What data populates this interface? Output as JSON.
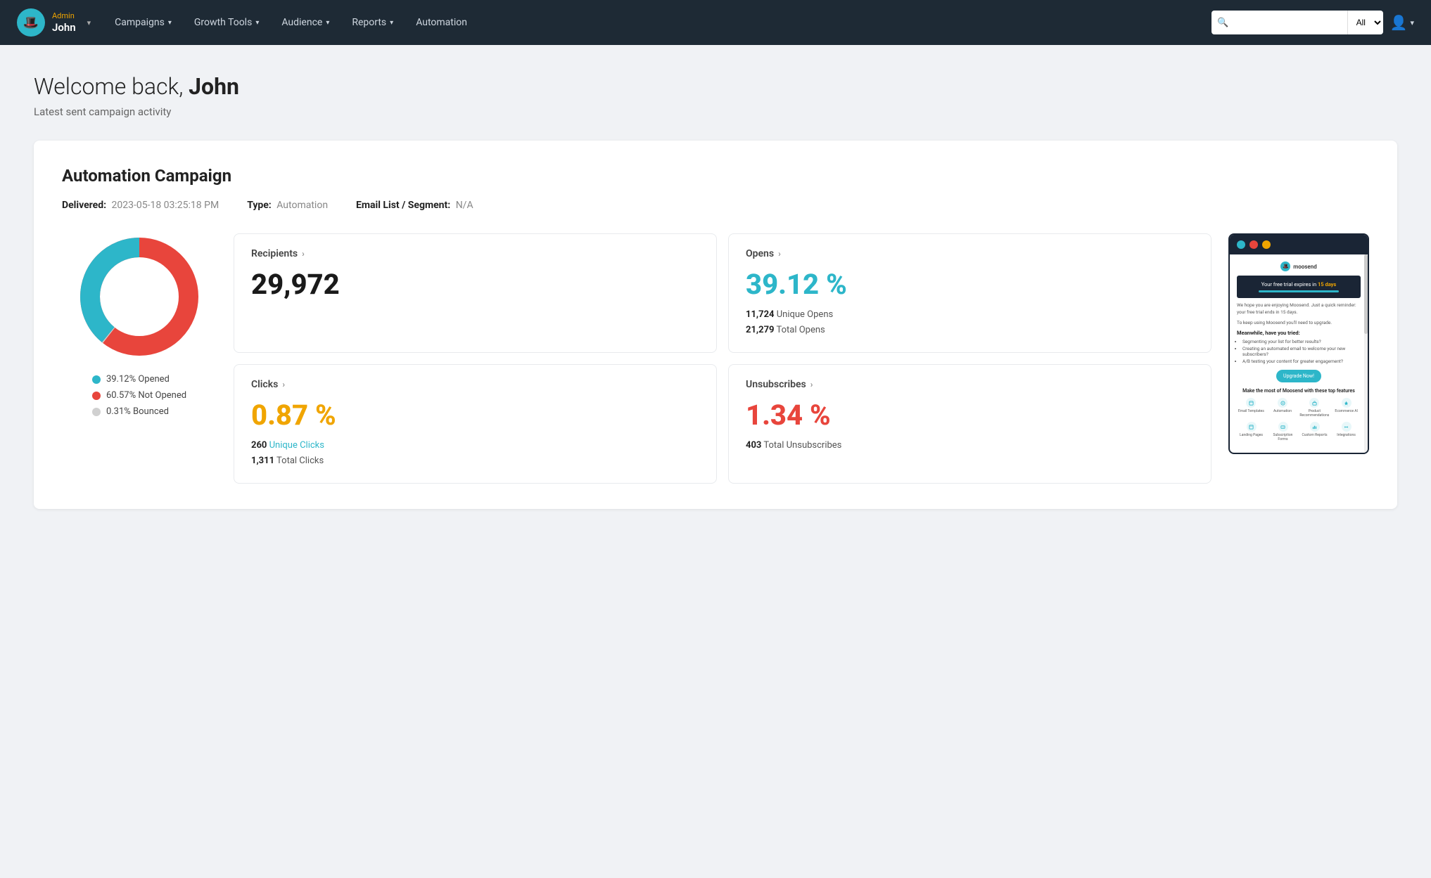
{
  "navbar": {
    "logo_emoji": "🎩",
    "user_role": "Admin",
    "user_name": "John",
    "nav_items": [
      {
        "label": "Campaigns",
        "has_dropdown": true
      },
      {
        "label": "Growth Tools",
        "has_dropdown": true
      },
      {
        "label": "Audience",
        "has_dropdown": true
      },
      {
        "label": "Reports",
        "has_dropdown": true
      },
      {
        "label": "Automation",
        "has_dropdown": false
      }
    ],
    "search_placeholder": "",
    "search_option": "All"
  },
  "page": {
    "welcome_text": "Welcome back, ",
    "welcome_name": "John",
    "subtitle": "Latest sent campaign activity"
  },
  "campaign": {
    "title": "Automation Campaign",
    "delivered_label": "Delivered:",
    "delivered_value": "2023-05-18 03:25:18 PM",
    "type_label": "Type:",
    "type_value": "Automation",
    "email_list_label": "Email List / Segment:",
    "email_list_value": "N/A"
  },
  "chart": {
    "opened_pct": 39.12,
    "not_opened_pct": 60.57,
    "bounced_pct": 0.31,
    "legend": [
      {
        "label": "39.12% Opened",
        "color": "#2db6c9"
      },
      {
        "label": "60.57% Not Opened",
        "color": "#e8453c"
      },
      {
        "label": "0.31% Bounced",
        "color": "#d0d0d0"
      }
    ]
  },
  "stats": {
    "recipients": {
      "label": "Recipients",
      "value": "29,972",
      "color": "dark"
    },
    "opens": {
      "label": "Opens",
      "value": "39.12 %",
      "color": "cyan",
      "unique_count": "11,724",
      "unique_label": "Unique Opens",
      "total_count": "21,279",
      "total_label": "Total Opens"
    },
    "clicks": {
      "label": "Clicks",
      "value": "0.87 %",
      "color": "yellow",
      "unique_count": "260",
      "unique_label": "Unique Clicks",
      "total_count": "1,311",
      "total_label": "Total Clicks"
    },
    "unsubscribes": {
      "label": "Unsubscribes",
      "value": "1.34 %",
      "color": "red",
      "total_count": "403",
      "total_label": "Total Unsubscribes"
    }
  },
  "email_preview": {
    "dots": [
      "teal",
      "red",
      "yellow"
    ],
    "logo_text": "moosend",
    "banner_text": "Your free trial expires in 15 days",
    "body_text1": "We hope you are enjoying Moosend. Just a quick reminder: your free trial ends in 15 days.",
    "body_text2": "To keep using Moosend you'll need to upgrade.",
    "heading": "Meanwhile, have you tried:",
    "list_items": [
      "Segmenting your list for better results?",
      "Creating an automated email to welcome your new subscribers?",
      "A/B testing your content for greater engagement?"
    ],
    "cta_label": "Upgrade Now!",
    "features_title": "Make the most of Moosend with these top features",
    "features": [
      "Email Templates",
      "Automation",
      "Product Recommendations",
      "Ecommerce AI",
      "Landing Pages",
      "Subscription Forms",
      "Custom Reports",
      "Integrations"
    ]
  }
}
